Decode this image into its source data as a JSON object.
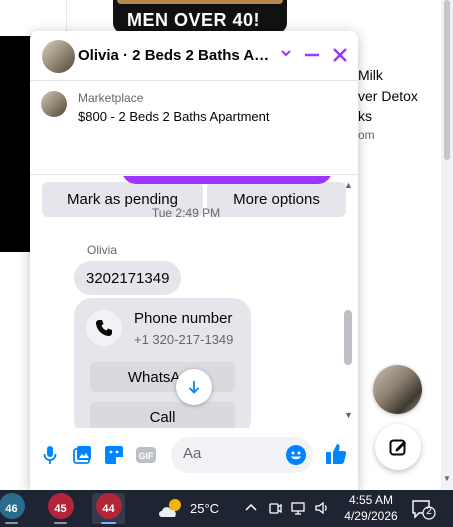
{
  "background_page": {
    "banner_text": "MEN OVER 40!",
    "side_text_lines": [
      "Milk",
      "ver Detox",
      "ks"
    ],
    "side_source": "om"
  },
  "chat": {
    "title": "Olivia · 2 Beds 2 Baths Apa...",
    "marketplace_label": "Marketplace",
    "listing_title": "$800 - 2 Beds 2 Baths Apartment",
    "mark_pending_label": "Mark as pending",
    "more_options_label": "More options",
    "timestamp": "Tue 2:49 PM",
    "sender_name": "Olivia",
    "phone_message": "3202171349",
    "call_card": {
      "title": "Phone number",
      "number": "+1 320-217-1349",
      "whatsapp_label": "WhatsApp",
      "call_label": "Call"
    },
    "composer": {
      "placeholder": "Aa"
    },
    "accent_color": "#a033ff",
    "brand_color": "#0084ff"
  },
  "taskbar": {
    "apps": [
      {
        "badge": "46",
        "active": false
      },
      {
        "badge": "45",
        "active": false
      },
      {
        "badge": "44",
        "active": true
      }
    ],
    "temperature": "25°C",
    "time": "4:55 AM",
    "date": "4/29/2026",
    "notification_count": "2"
  }
}
